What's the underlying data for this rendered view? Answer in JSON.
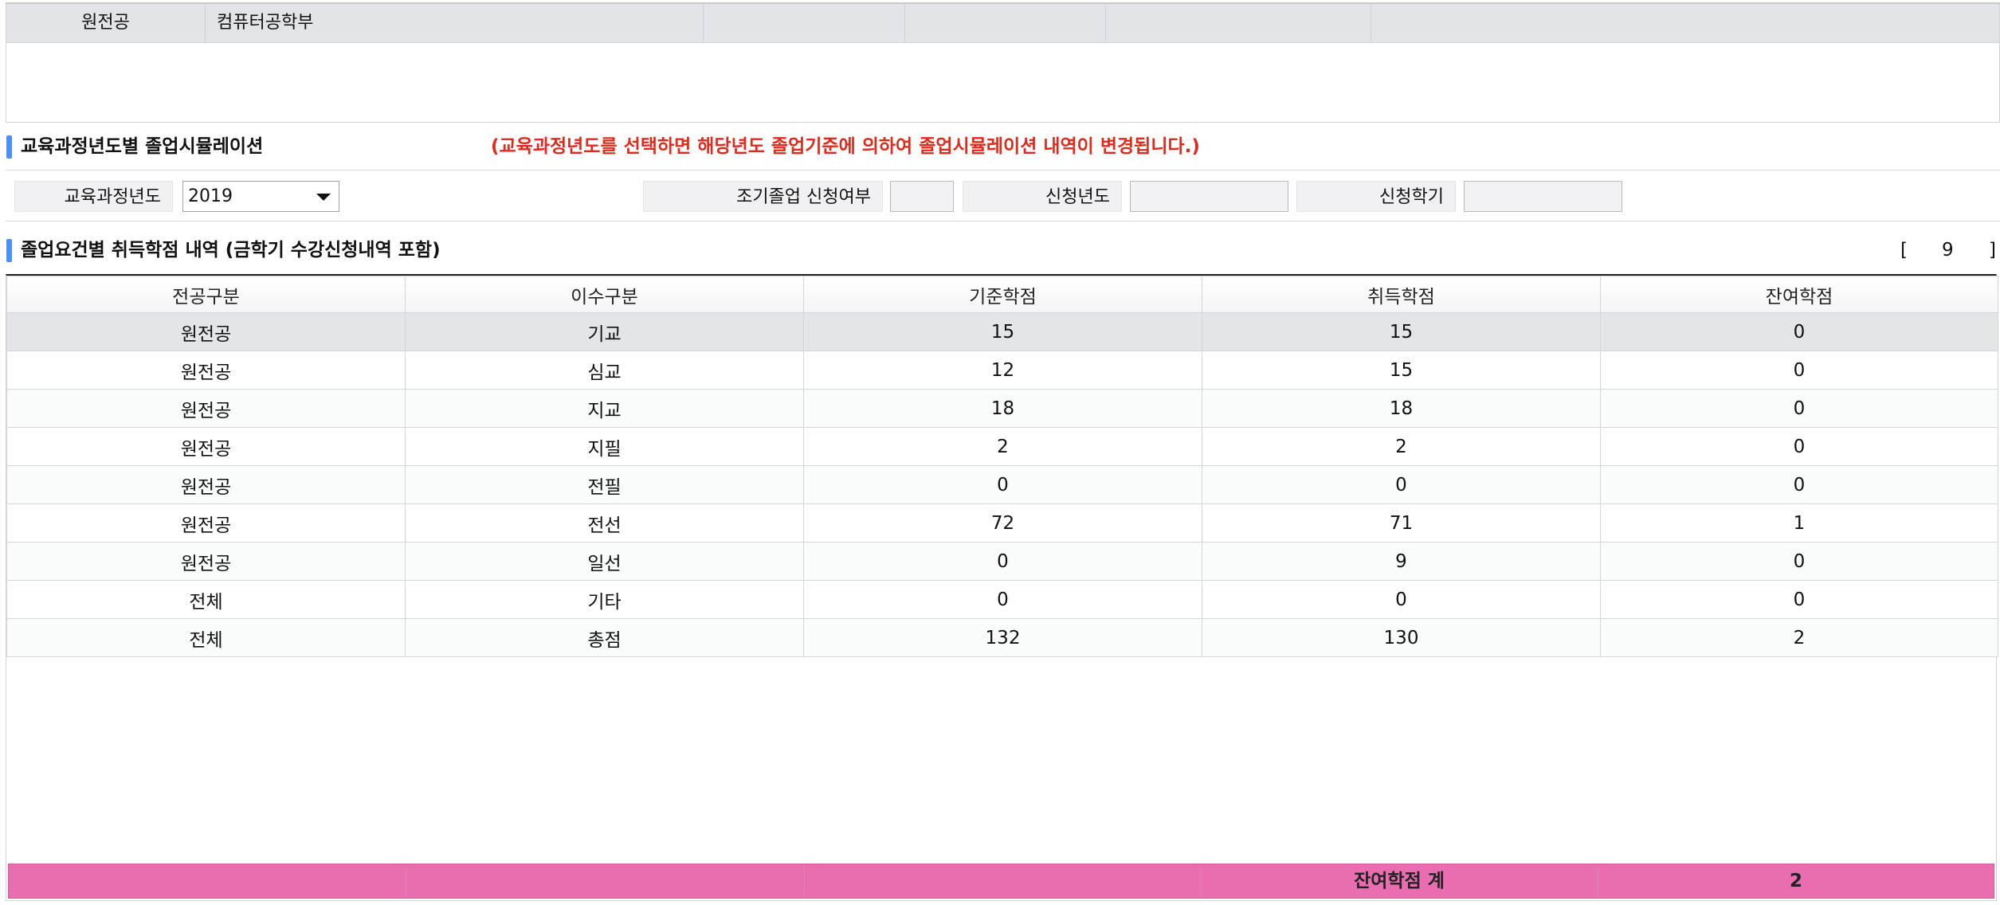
{
  "top_grid": {
    "row": [
      "원전공",
      "컴퓨터공학부",
      "",
      "",
      "",
      ""
    ]
  },
  "simulation": {
    "title": "교육과정년도별 졸업시뮬레이션",
    "notice": "(교육과정년도를 선택하면 해당년도 졸업기준에 의하여 졸업시뮬레이션 내역이 변경됩니다.)"
  },
  "filters": {
    "curriculum_year_label": "교육과정년도",
    "curriculum_year_value": "2019",
    "early_grad_label": "조기졸업 신청여부",
    "early_grad_value": "",
    "apply_year_label": "신청년도",
    "apply_year_value": "",
    "apply_term_label": "신청학기",
    "apply_term_value": ""
  },
  "credits": {
    "title": "졸업요건별 취득학점 내역 (금학기 수강신청내역 포함)",
    "page_open": "[",
    "page_count": "9",
    "page_close": "]",
    "columns": [
      "전공구분",
      "이수구분",
      "기준학점",
      "취득학점",
      "잔여학점"
    ],
    "rows": [
      [
        "원전공",
        "기교",
        "15",
        "15",
        "0"
      ],
      [
        "원전공",
        "심교",
        "12",
        "15",
        "0"
      ],
      [
        "원전공",
        "지교",
        "18",
        "18",
        "0"
      ],
      [
        "원전공",
        "지필",
        "2",
        "2",
        "0"
      ],
      [
        "원전공",
        "전필",
        "0",
        "0",
        "0"
      ],
      [
        "원전공",
        "전선",
        "72",
        "71",
        "1"
      ],
      [
        "원전공",
        "일선",
        "0",
        "9",
        "0"
      ],
      [
        "전체",
        "기타",
        "0",
        "0",
        "0"
      ],
      [
        "전체",
        "총점",
        "132",
        "130",
        "2"
      ]
    ],
    "footer": [
      "",
      "",
      "",
      "잔여학점 계",
      "2"
    ]
  },
  "colors": {
    "accent_bar": "#4a8fff",
    "notice_text": "#e02a1b",
    "footer_bg": "#e96db0"
  }
}
